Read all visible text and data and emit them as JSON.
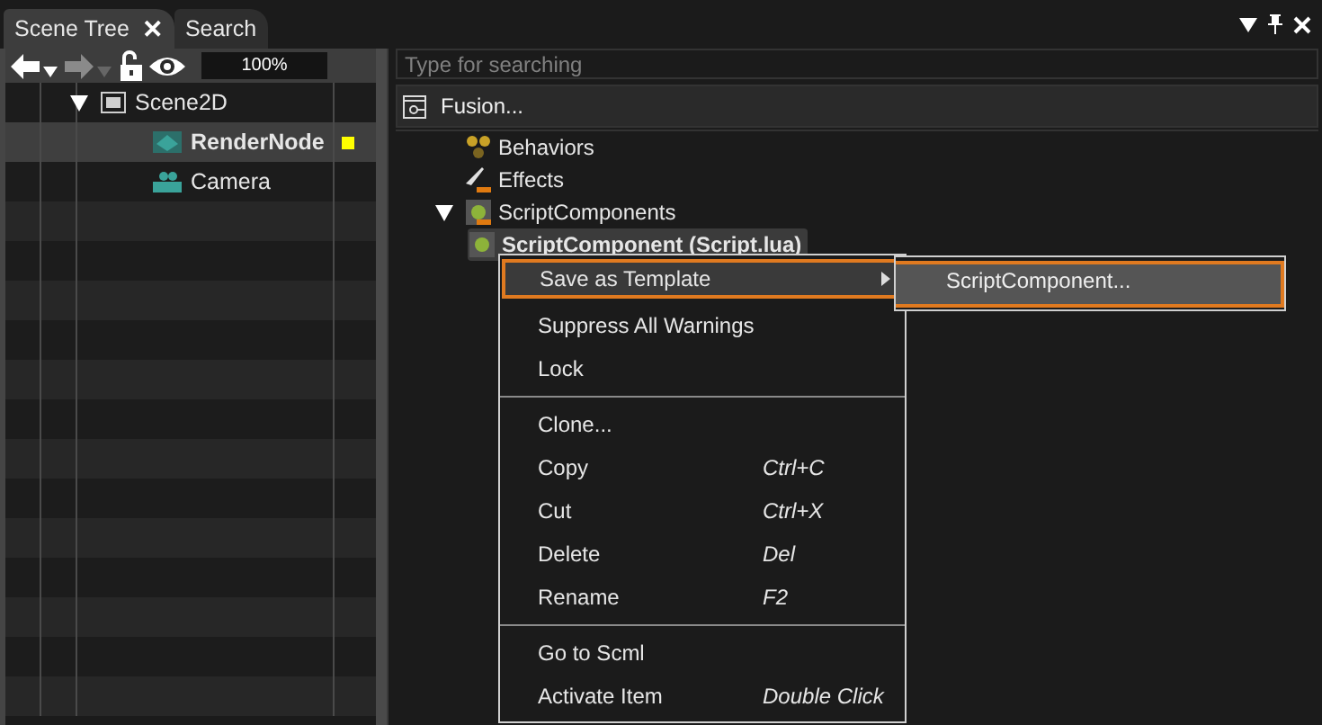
{
  "tabs": [
    {
      "label": "Scene Tree",
      "selected": true,
      "close": "✕"
    },
    {
      "label": "Search",
      "selected": false
    }
  ],
  "toolbar": {
    "back_enabled": true,
    "forward_enabled": false,
    "zoom": "100%"
  },
  "scene_tree": [
    {
      "label": "Scene2D",
      "kind": "scene",
      "expanded": true,
      "selected": false,
      "children": [
        {
          "label": "RenderNode",
          "kind": "render",
          "selected": true,
          "color": "#ffff00"
        },
        {
          "label": "Camera",
          "kind": "camera",
          "selected": false
        }
      ]
    }
  ],
  "search": {
    "placeholder": "Type for searching"
  },
  "fusion": {
    "label": "Fusion..."
  },
  "component_tree": [
    {
      "label": "Behaviors",
      "kind": "behaviors",
      "selected": false
    },
    {
      "label": "Effects",
      "kind": "effects",
      "selected": false
    },
    {
      "label": "ScriptComponents",
      "kind": "scripts",
      "expanded": true,
      "selected": false,
      "children": [
        {
          "label": "ScriptComponent (Script.lua)",
          "kind": "script",
          "selected": true
        }
      ]
    }
  ],
  "context_menu": [
    {
      "kind": "item",
      "label": "Save as Template",
      "submenu": true,
      "selected": true
    },
    {
      "kind": "item",
      "label": "Suppress All Warnings",
      "selected": false
    },
    {
      "kind": "item",
      "label": "Lock",
      "selected": false
    },
    {
      "kind": "separator"
    },
    {
      "kind": "item",
      "label": "Clone...",
      "selected": false
    },
    {
      "kind": "item",
      "label": "Copy",
      "shortcut": "Ctrl+C",
      "selected": false
    },
    {
      "kind": "item",
      "label": "Cut",
      "shortcut": "Ctrl+X",
      "selected": false
    },
    {
      "kind": "item",
      "label": "Delete",
      "shortcut": "Del",
      "selected": false
    },
    {
      "kind": "item",
      "label": "Rename",
      "shortcut": "F2",
      "selected": false
    },
    {
      "kind": "separator"
    },
    {
      "kind": "item",
      "label": "Go to Scml",
      "selected": false
    },
    {
      "kind": "item",
      "label": "Activate Item",
      "shortcut": "Double Click",
      "selected": false
    }
  ],
  "submenu": [
    {
      "label": "ScriptComponent...",
      "selected": true
    }
  ]
}
